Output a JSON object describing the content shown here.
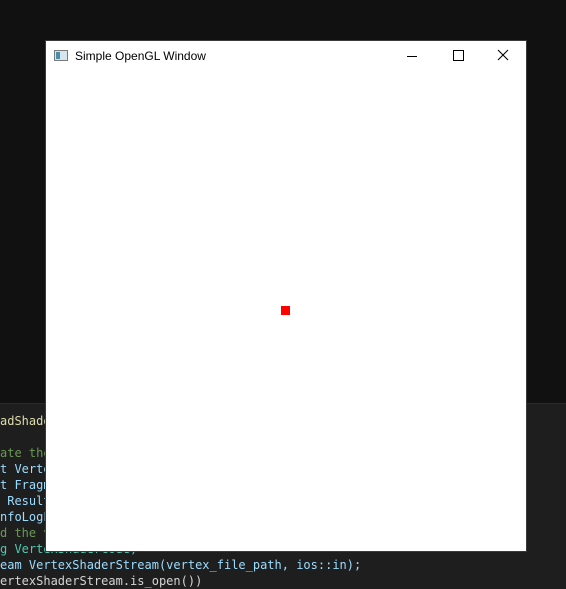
{
  "window": {
    "title": "Simple OpenGL Window",
    "point_color": "#ff0000",
    "background_color": "#ffffff"
  },
  "editor": {
    "lines": [
      "adShade",
      "",
      "ate the",
      "t Verte",
      "t Fragm",
      " Result",
      "nfoLogL",
      "d the v",
      "g VertexShaderCode;",
      "eam VertexShaderStream(vertex_file_path, ios::in);",
      "ertexShaderStream.is_open())"
    ]
  }
}
